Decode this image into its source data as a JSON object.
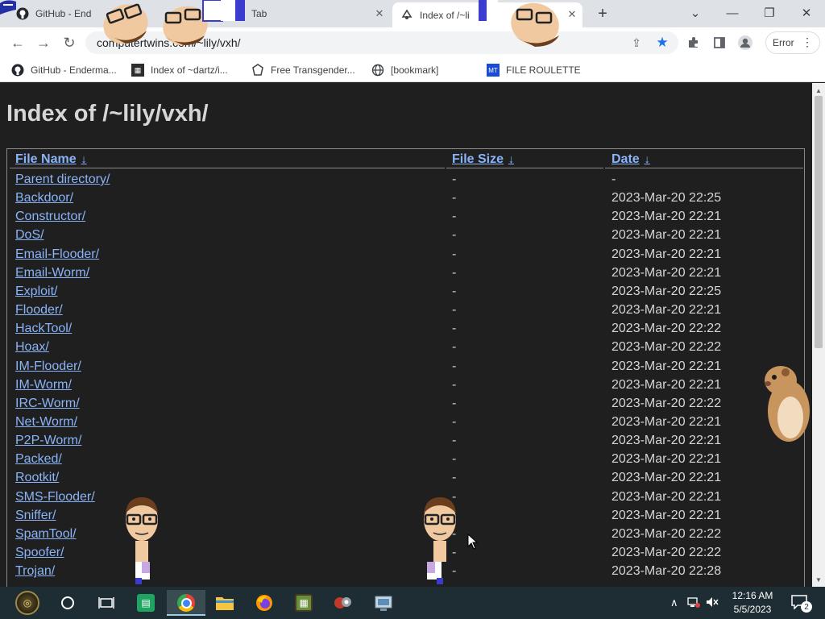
{
  "browser": {
    "tabs": [
      {
        "title": "GitHub - End",
        "icon": "github-icon"
      },
      {
        "title": "Tab",
        "icon": ""
      },
      {
        "title": "Index of /~li",
        "icon": "site-icon"
      }
    ],
    "new_tab_symbol": "+",
    "window_controls": {
      "dropdown": "⌄",
      "minimize": "—",
      "restore": "❐",
      "close": "✕"
    },
    "address": "computertwins.com/~lily/vxh/",
    "error_label": "Error",
    "bookmarks": [
      {
        "label": "GitHub - Enderma...",
        "icon": "github-icon"
      },
      {
        "label": "Index of ~dartz/i...",
        "icon": "grid-icon"
      },
      {
        "label": "Free Transgender...",
        "icon": "badge-icon"
      },
      {
        "label": "[bookmark]",
        "icon": "globe-icon"
      },
      {
        "label": "FILE ROULETTE",
        "icon": "file-icon"
      }
    ]
  },
  "page": {
    "heading": "Index of /~lily/vxh/",
    "columns": {
      "name": "File Name",
      "size": "File Size",
      "date": "Date",
      "sort_arrow": "↓"
    },
    "entries": [
      {
        "name": "Parent directory/",
        "size": "-",
        "date": "-"
      },
      {
        "name": "Backdoor/",
        "size": "-",
        "date": "2023-Mar-20 22:25"
      },
      {
        "name": "Constructor/",
        "size": "-",
        "date": "2023-Mar-20 22:21"
      },
      {
        "name": "DoS/",
        "size": "-",
        "date": "2023-Mar-20 22:21"
      },
      {
        "name": "Email-Flooder/",
        "size": "-",
        "date": "2023-Mar-20 22:21"
      },
      {
        "name": "Email-Worm/",
        "size": "-",
        "date": "2023-Mar-20 22:21"
      },
      {
        "name": "Exploit/",
        "size": "-",
        "date": "2023-Mar-20 22:25"
      },
      {
        "name": "Flooder/",
        "size": "-",
        "date": "2023-Mar-20 22:21"
      },
      {
        "name": "HackTool/",
        "size": "-",
        "date": "2023-Mar-20 22:22"
      },
      {
        "name": "Hoax/",
        "size": "-",
        "date": "2023-Mar-20 22:22"
      },
      {
        "name": "IM-Flooder/",
        "size": "-",
        "date": "2023-Mar-20 22:21"
      },
      {
        "name": "IM-Worm/",
        "size": "-",
        "date": "2023-Mar-20 22:21"
      },
      {
        "name": "IRC-Worm/",
        "size": "-",
        "date": "2023-Mar-20 22:22"
      },
      {
        "name": "Net-Worm/",
        "size": "-",
        "date": "2023-Mar-20 22:21"
      },
      {
        "name": "P2P-Worm/",
        "size": "-",
        "date": "2023-Mar-20 22:21"
      },
      {
        "name": "Packed/",
        "size": "-",
        "date": "2023-Mar-20 22:21"
      },
      {
        "name": "Rootkit/",
        "size": "-",
        "date": "2023-Mar-20 22:21"
      },
      {
        "name": "SMS-Flooder/",
        "size": "-",
        "date": "2023-Mar-20 22:21"
      },
      {
        "name": "Sniffer/",
        "size": "-",
        "date": "2023-Mar-20 22:21"
      },
      {
        "name": "SpamTool/",
        "size": "-",
        "date": "2023-Mar-20 22:22"
      },
      {
        "name": "Spoofer/",
        "size": "-",
        "date": "2023-Mar-20 22:22"
      },
      {
        "name": "Trojan/",
        "size": "-",
        "date": "2023-Mar-20 22:28"
      }
    ]
  },
  "taskbar": {
    "apps": [
      "start-orb",
      "search",
      "task-view",
      "sheets",
      "chrome",
      "file-explorer",
      "firefox",
      "minecraft",
      "game-app",
      "control-panel"
    ],
    "time": "12:16 AM",
    "date": "5/5/2023",
    "notification_count": "2"
  },
  "colors": {
    "page_bg": "#1f1f1f",
    "link": "#8ab4f8",
    "text": "#d6d6d6",
    "taskbar": "#1e2d33",
    "star": "#1a73e8"
  }
}
